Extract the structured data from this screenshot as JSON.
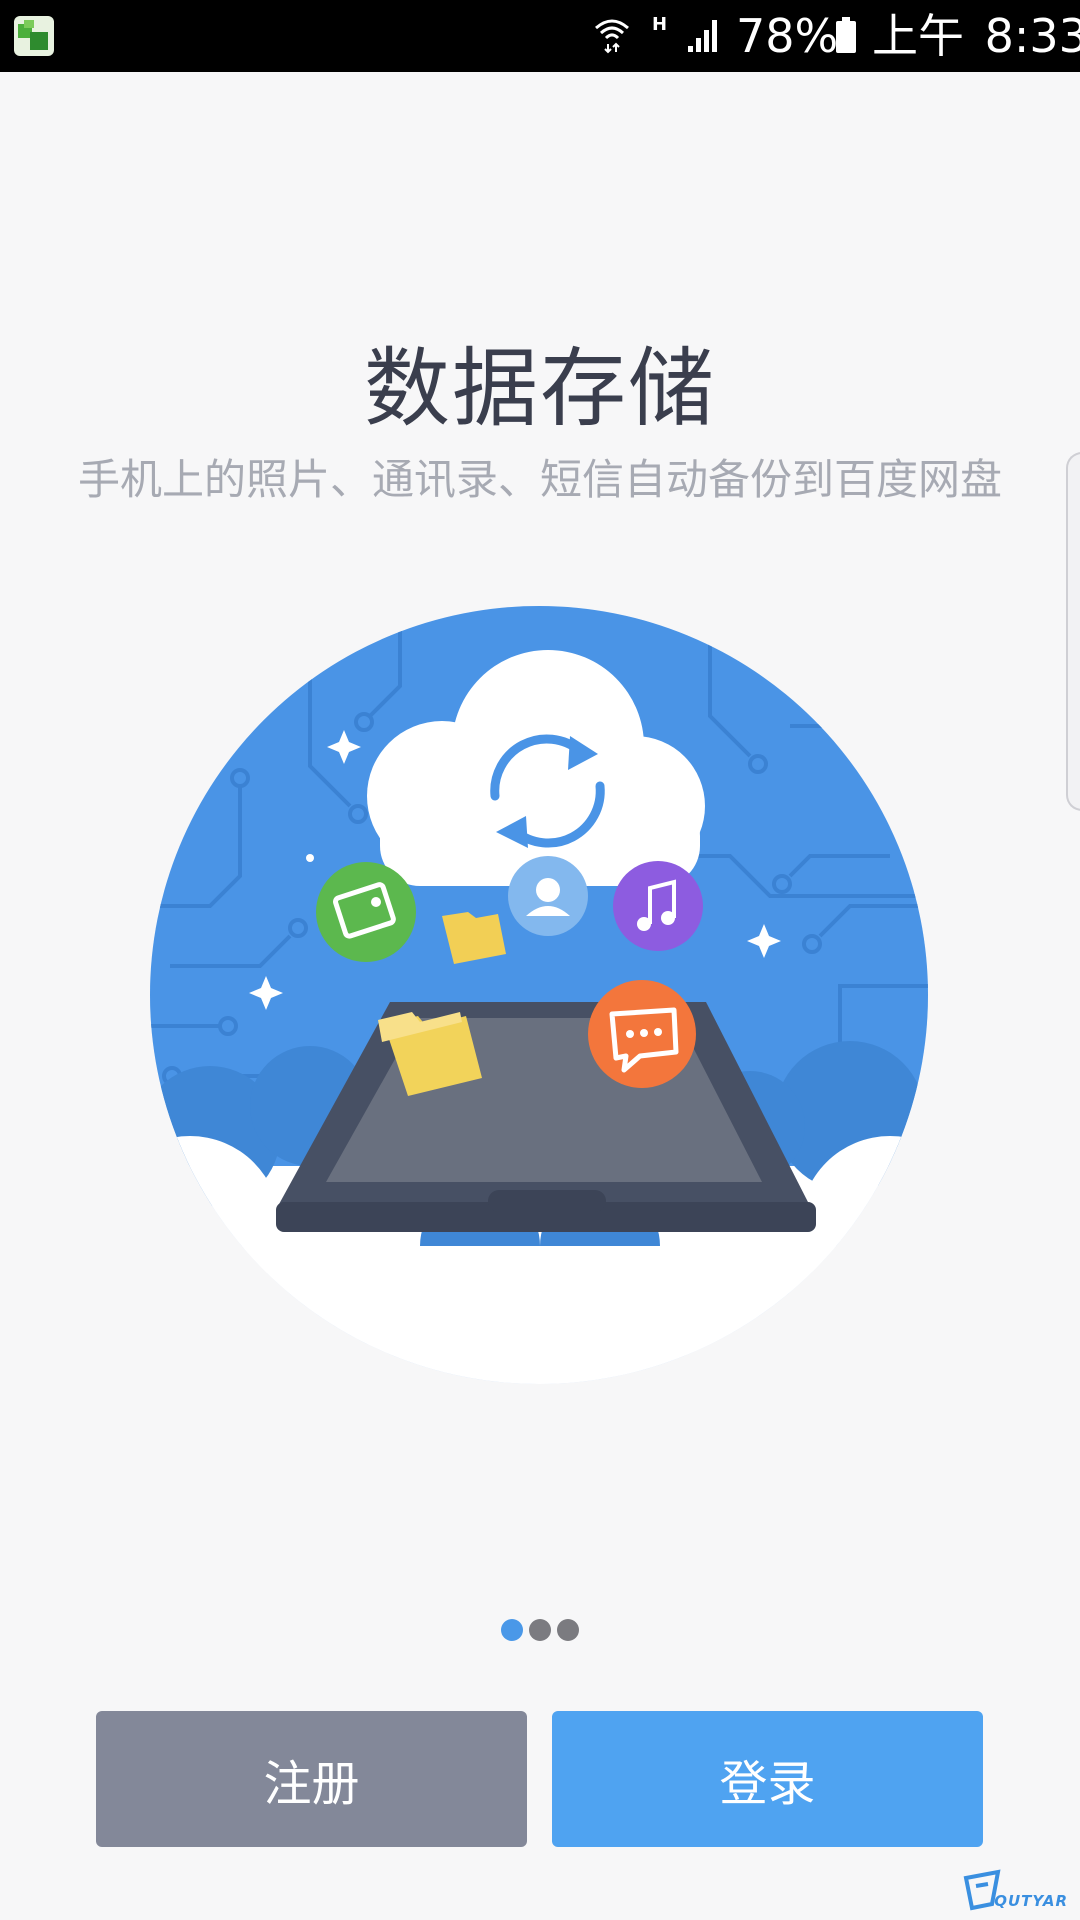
{
  "status_bar": {
    "network_type": "H",
    "battery": "78%",
    "time_period": "上午",
    "time": "8:33",
    "icons": [
      "app-icon",
      "wifi-icon",
      "signal-icon",
      "battery-icon"
    ]
  },
  "onboarding": {
    "title": "数据存储",
    "subtitle": "手机上的照片、通讯录、短信自动备份到百度网盘",
    "page_count": 3,
    "active_page": 1,
    "illustration_icons": [
      "cloud-sync-icon",
      "photo-icon",
      "folder-icon",
      "contact-icon",
      "music-icon",
      "message-icon",
      "tablet-device"
    ]
  },
  "actions": {
    "register_label": "注册",
    "login_label": "登录"
  },
  "watermark": {
    "text": "QUTYAR"
  },
  "colors": {
    "accent": "#4fa3f1",
    "register_button": "#838899",
    "circle_blue": "#4a94e6",
    "title_text": "#3a3e4d",
    "subtitle_text": "#a7aab3"
  }
}
